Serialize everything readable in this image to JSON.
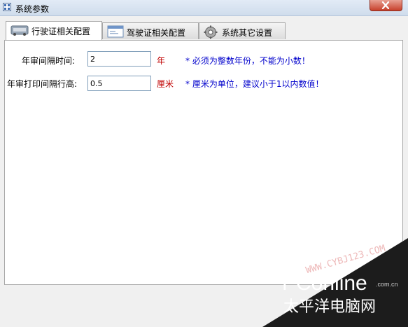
{
  "window": {
    "title": "系统参数"
  },
  "tabs": [
    {
      "label": "行驶证相关配置",
      "active": true
    },
    {
      "label": "驾驶证相关配置",
      "active": false
    },
    {
      "label": "系统其它设置",
      "active": false
    }
  ],
  "fields": [
    {
      "label": "年审间隔时间:",
      "value": "2",
      "unit": "年",
      "hint": "* 必须为整数年份，不能为小数！"
    },
    {
      "label": "年审打印间隔行高:",
      "value": "0.5",
      "unit": "厘米",
      "hint": "* 厘米为单位，建议小于1以内数值！"
    }
  ],
  "watermark": {
    "site_text": "WWW.CYBJ123.COM",
    "logo_text": "PConline",
    "domain_suffix": ".com.cn",
    "brand_cn": "太平洋电脑网"
  },
  "colors": {
    "unit": "#c00000",
    "hint": "#0000cc",
    "close": "#c7402b"
  }
}
